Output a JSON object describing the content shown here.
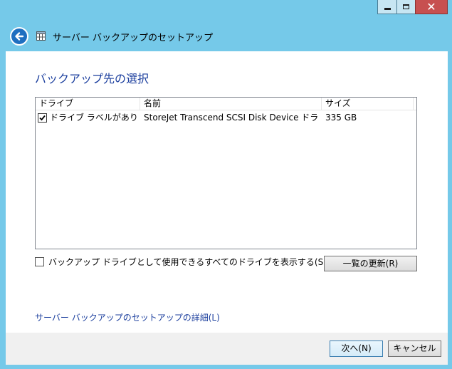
{
  "window": {
    "title": "サーバー バックアップのセットアップ",
    "close_glyph": "✕"
  },
  "icons": {
    "back": "back-arrow-icon",
    "app": "backup-app-icon",
    "minimize": "minimize-icon",
    "maximize": "maximize-icon",
    "close": "close-icon",
    "checkbox_checked": "checkmark-icon"
  },
  "colors": {
    "frame": "#75c9e9",
    "heading": "#1c3f9e",
    "close_button": "#c75050",
    "back_button": "#1f6fc0"
  },
  "page": {
    "heading": "バックアップ先の選択"
  },
  "list": {
    "columns": [
      "ドライブ",
      "名前",
      "サイズ"
    ],
    "rows": [
      {
        "checked": true,
        "drive": "ドライブ ラベルがありま...",
        "name": "StoreJet Transcend SCSI Disk Device ドライブ...",
        "size": "335 GB"
      }
    ]
  },
  "options": {
    "show_all_label": "バックアップ ドライブとして使用できるすべてのドライブを表示する(S)",
    "show_all_checked": false
  },
  "buttons": {
    "refresh": "一覧の更新(R)",
    "next": "次へ(N)",
    "cancel": "キャンセル"
  },
  "links": {
    "details": "サーバー バックアップのセットアップの詳細(L)"
  }
}
